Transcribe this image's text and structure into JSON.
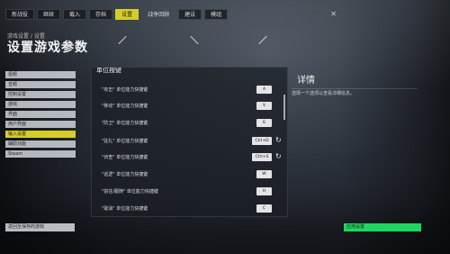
{
  "colors": {
    "accent_yellow": "#d6cc2a",
    "apply_green": "#1ed760"
  },
  "nav": {
    "tabs": [
      "新战役",
      "继续",
      "载入",
      "存档",
      "设置",
      "建设",
      "模组",
      "退出"
    ],
    "active_index": 4,
    "extra_tab": "战争回顾",
    "close_icon": "x-icon"
  },
  "breadcrumb": "游戏设置 / 设置",
  "page_title": "设置游戏参数",
  "sidebar": {
    "items": [
      "视频",
      "音频",
      "控制设置",
      "游戏",
      "界面",
      "用户界面",
      "输入设置",
      "辅助功能",
      "Steam"
    ],
    "active_index": 6
  },
  "main": {
    "section_title": "单位按键",
    "rows": [
      {
        "label": "\"攻击\" 单位能力快捷键",
        "key": "A",
        "reset_icon": "",
        "wide": false
      },
      {
        "label": "\"移动\" 单位能力快捷键",
        "key": "V",
        "reset_icon": "",
        "wide": false
      },
      {
        "label": "\"防卫\" 单位能力快捷键",
        "key": "G",
        "reset_icon": "",
        "wide": false
      },
      {
        "label": "\"驻扎\" 单位能力快捷键",
        "key": "Ctrl+D",
        "reset_icon": "↻",
        "wide": true
      },
      {
        "label": "\"侦查\" 单位能力快捷键",
        "key": "Ctrl+S",
        "reset_icon": "↻",
        "wide": true
      },
      {
        "label": "\"巡逻\" 单位能力快捷键",
        "key": "W",
        "reset_icon": "",
        "wide": false
      },
      {
        "label": "\"前往/跟随\" 单位能力快捷键",
        "key": "H",
        "reset_icon": "",
        "wide": false
      },
      {
        "label": "\"取消\" 单位能力快捷键",
        "key": "C",
        "reset_icon": "",
        "wide": false
      }
    ]
  },
  "details": {
    "title": "详情",
    "description": "选择一个选项以查看详细信息。"
  },
  "bottom": {
    "back_label": "返回至保存的游戏",
    "apply_label": "应用设置"
  }
}
